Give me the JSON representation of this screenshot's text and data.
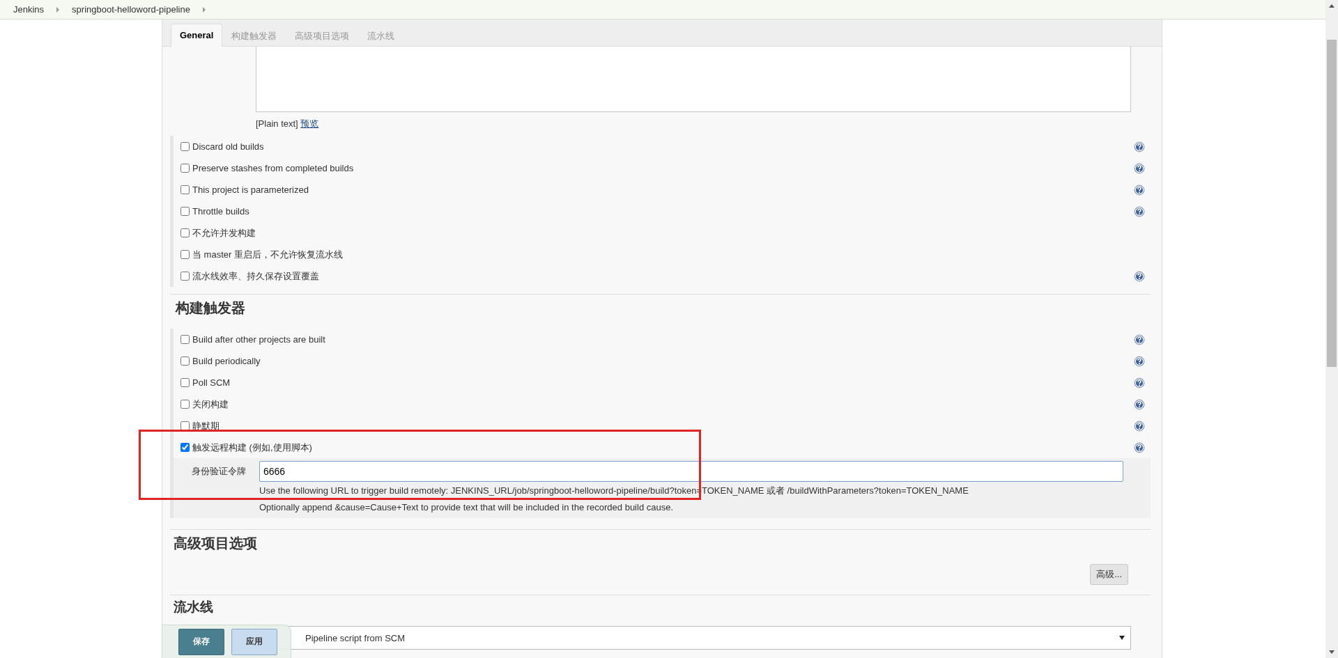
{
  "breadcrumbs": [
    {
      "label": "Jenkins"
    },
    {
      "label": "springboot-helloword-pipeline"
    }
  ],
  "tabs": [
    {
      "label": "General",
      "selected": true
    },
    {
      "label": "构建触发器",
      "selected": false
    },
    {
      "label": "高级项目选项",
      "selected": false
    },
    {
      "label": "流水线",
      "selected": false
    }
  ],
  "description": {
    "format_note": "[Plain text]",
    "preview_link": "预览"
  },
  "general_options": [
    {
      "label": "Discard old builds",
      "checked": false,
      "help": true
    },
    {
      "label": "Preserve stashes from completed builds",
      "checked": false,
      "help": true
    },
    {
      "label": "This project is parameterized",
      "checked": false,
      "help": true
    },
    {
      "label": "Throttle builds",
      "checked": false,
      "help": true
    },
    {
      "label": "不允许并发构建",
      "checked": false,
      "help": false
    },
    {
      "label": "当 master 重启后，不允许恢复流水线",
      "checked": false,
      "help": false
    },
    {
      "label": "流水线效率、持久保存设置覆盖",
      "checked": false,
      "help": true
    }
  ],
  "build_triggers": {
    "title": "构建触发器",
    "options": [
      {
        "label": "Build after other projects are built",
        "checked": false,
        "help": true
      },
      {
        "label": "Build periodically",
        "checked": false,
        "help": true
      },
      {
        "label": "Poll SCM",
        "checked": false,
        "help": true
      },
      {
        "label": "关闭构建",
        "checked": false,
        "help": true
      },
      {
        "label": "静默期",
        "checked": false,
        "help": true
      },
      {
        "label": "触发远程构建 (例如,使用脚本)",
        "checked": true,
        "help": true,
        "token_field": {
          "label": "身份验证令牌",
          "value": "6666",
          "hints": [
            "Use the following URL to trigger build remotely: JENKINS_URL/job/springboot-helloword-pipeline/build?token=TOKEN_NAME 或者 /buildWithParameters?token=TOKEN_NAME",
            "Optionally append &cause=Cause+Text to provide text that will be included in the recorded build cause."
          ]
        }
      }
    ]
  },
  "advanced_options": {
    "title": "高级项目选项",
    "button": "高级..."
  },
  "pipeline": {
    "title": "流水线",
    "definition": "Pipeline script from SCM"
  },
  "save_bar": {
    "buttons": [
      {
        "label": "保存",
        "kind": "primary"
      },
      {
        "label": "应用",
        "kind": "secondary"
      }
    ]
  }
}
